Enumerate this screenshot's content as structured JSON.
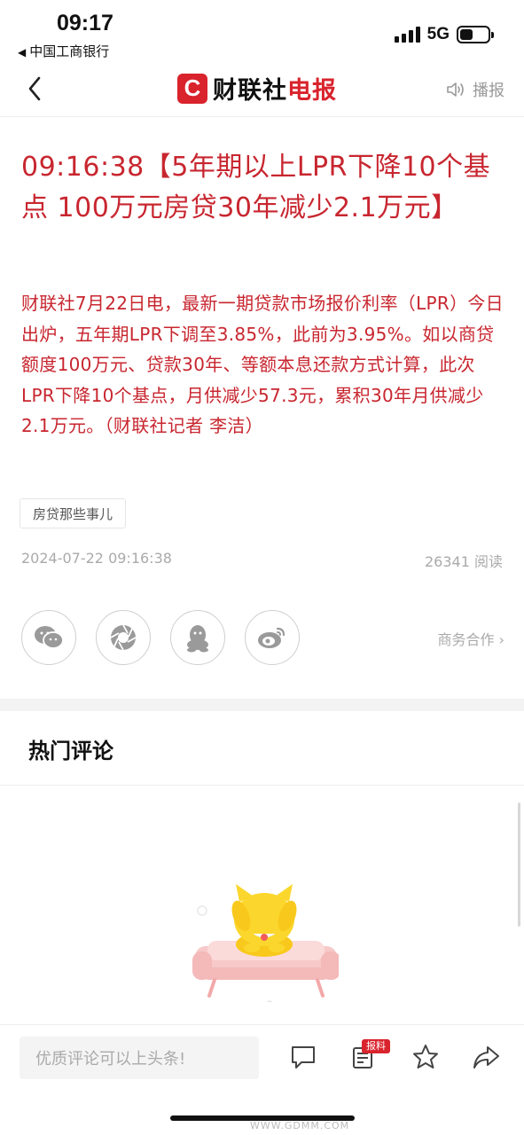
{
  "status_bar": {
    "time": "09:17",
    "back_app": "中国工商银行",
    "network": "5G",
    "back_arrow_icon": "left-triangle-icon",
    "signal_icon": "signal-bars-icon",
    "battery_icon": "battery-icon"
  },
  "nav": {
    "logo_letter": "C",
    "logo_text_black": "财联社",
    "logo_text_red": "电报",
    "broadcast_label": "播报",
    "back_icon": "chevron-left-icon",
    "speaker_icon": "speaker-icon",
    "brand_color": "#d9232d"
  },
  "article": {
    "headline": "09:16:38【5年期以上LPR下降10个基点 100万元房贷30年减少2.1万元】",
    "body": "财联社7月22日电，最新一期贷款市场报价利率（LPR）今日出炉，五年期LPR下调至3.85%，此前为3.95%。如以商贷额度100万元、贷款30年、等额本息还款方式计算，此次LPR下降10个基点，月供减少57.3元，累积30年月供减少2.1万元。（财联社记者 李洁）",
    "tag": "房贷那些事儿",
    "datetime": "2024-07-22 09:16:38",
    "read_count": "26341 阅读",
    "text_color": "#c8262f"
  },
  "share": {
    "icons": [
      "wechat-icon",
      "moments-icon",
      "qq-icon",
      "weibo-icon"
    ],
    "business_label": "商务合作 ›"
  },
  "comments": {
    "title": "热门评论",
    "empty_illustration": "cat-on-sofa-illustration"
  },
  "bottom_bar": {
    "input_placeholder": "优质评论可以上头条!",
    "badge_label": "报料",
    "icons": [
      "comment-icon",
      "report-icon",
      "star-icon",
      "share-icon"
    ]
  },
  "watermark": "WWW.GDMM.COM"
}
